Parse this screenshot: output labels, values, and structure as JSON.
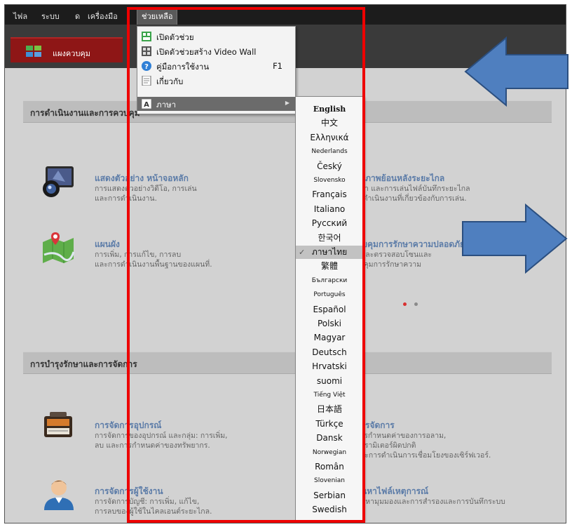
{
  "menubar": {
    "items": [
      "ไฟล",
      "ระบบ",
      "ด",
      "เครื่องมือ"
    ],
    "active": "ช่วยเหลือ"
  },
  "tab": {
    "label": "แผงควบคุม"
  },
  "help_menu": {
    "items": [
      {
        "label": "เปิดตัวช่วย",
        "icon": "wizard-icon"
      },
      {
        "label": "เปิดตัวช่วยสร้าง Video Wall",
        "icon": "video-wall-icon"
      },
      {
        "label": "คู่มือการใช้งาน",
        "icon": "help-icon",
        "shortcut": "F1"
      },
      {
        "label": "เกี่ยวกับ",
        "icon": "document-icon"
      },
      {
        "label": "ภาษา",
        "icon": "language-icon",
        "highlighted": true
      }
    ]
  },
  "language_menu": {
    "items": [
      "English",
      "中文",
      "Ελληνικά",
      "Nederlands",
      "Český",
      "Slovensko",
      "Français",
      "Italiano",
      "Русский",
      "한국어",
      "ภาษาไทย",
      "繁體",
      "Български",
      "Português",
      "Español",
      "Polski",
      "Magyar",
      "Deutsch",
      "Hrvatski",
      "suomi",
      "Tiếng Việt",
      "日本語",
      "Türkçe",
      "Dansk",
      "Norwegian",
      "Român",
      "Slovenian",
      "Serbian",
      "Swedish"
    ],
    "selected": "ภาษาไทย"
  },
  "sections": {
    "operation": {
      "title": "การดำเนินงานและการ",
      "title_tail": "ควบคุม"
    },
    "maintenance": {
      "title": "การบำรุงรักษาและการจัดการ"
    }
  },
  "features": {
    "live_view": {
      "title": "แสดงตัวอย่าง หน้าจอหลัก",
      "desc1": "การแสดงตัวอย่างวิดีโอ, การเล่น",
      "desc2": "และการดำเนินงาน."
    },
    "remote_playback": {
      "title": "การเล่นภาพย้อนหลังระยะไกล",
      "desc1": "การค้นหา และการเล่นไฟล์บันทึกระยะไกล",
      "desc2": "และการดำเนินงานที่เกี่ยวข้องกับการเล่น."
    },
    "emap": {
      "title": "แผนผัง",
      "desc1": "การเพิ่ม, การแก้ไข, การลบ",
      "desc2": "และการดำเนินงานพื้นฐานของแผนที่."
    },
    "security": {
      "title": "แผงควบคุมการรักษาความปลอดภัย",
      "desc1": "ควบคุมและตรวจสอบโซนและ",
      "desc2": "แผงควบคุมการรักษาความ"
    },
    "device_mgmt": {
      "title": "การจัดการอุปกรณ์",
      "desc1": "การจัดการของอุปกรณ์ และกลุ่ม: การเพิ่ม,",
      "desc2": "ลบ และการกำหนดค่าของทรัพยากร."
    },
    "event_mgmt": {
      "title": "การจัดการ",
      "desc1": "การกำหนดค่าของการอลาม,",
      "desc2": "พารามิเตอร์ผิดปกติ",
      "desc3": "และการดำเนินการเชื่อมโยงของเซิร์ฟเวอร์."
    },
    "user_mgmt": {
      "title": "การจัดการผู้ใช้งาน",
      "desc1": "การจัดการบัญชี: การเพิ่ม, แก้ไข,",
      "desc2": "การลบของผู้ใช้ในไคลเอนต์ระยะไกล."
    },
    "log_search": {
      "title": "ค้นหาไฟล์เหตุการณ์",
      "desc1": "ค้นหามุมมองและการสำรองและการบันทึกระบบ"
    }
  },
  "colors": {
    "accent_red": "#ee0000",
    "arrow_blue": "#4f7fbf",
    "tab_red": "#8e1616"
  }
}
